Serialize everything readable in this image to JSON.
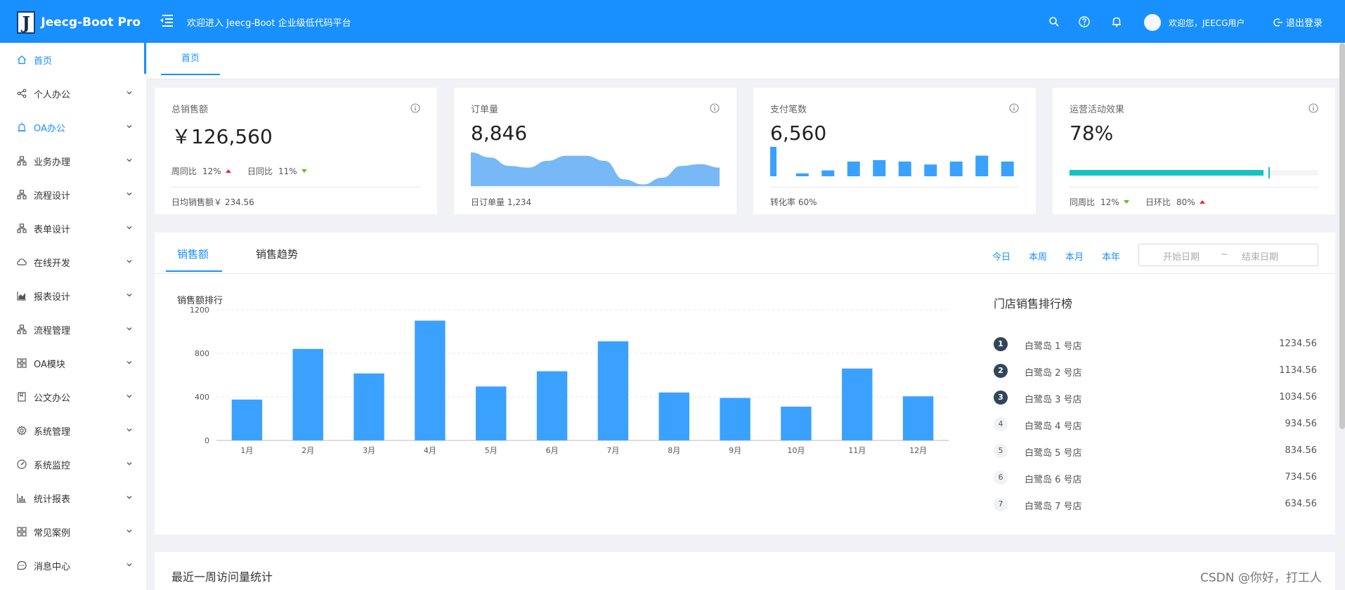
{
  "header": {
    "app_name": "Jeecg-Boot Pro",
    "logo_letter": "J",
    "welcome": "欢迎进入 Jeecg-Boot 企业级低代码平台",
    "user_greeting": "欢迎您，JEECG用户",
    "logout": "退出登录",
    "icons": [
      "menu-fold-icon",
      "search-icon",
      "question-icon",
      "bell-icon",
      "logout-icon"
    ]
  },
  "sidebar": {
    "items": [
      {
        "label": "首页",
        "icon": "home-icon",
        "active": true,
        "chevron": false
      },
      {
        "label": "个人办公",
        "icon": "share-icon",
        "active": false,
        "chevron": true
      },
      {
        "label": "OA办公",
        "icon": "alarm-icon",
        "active": true,
        "chevron": true
      },
      {
        "label": "业务办理",
        "icon": "cluster-icon",
        "active": false,
        "chevron": true
      },
      {
        "label": "流程设计",
        "icon": "cluster-icon",
        "active": false,
        "chevron": true
      },
      {
        "label": "表单设计",
        "icon": "cluster-icon",
        "active": false,
        "chevron": true
      },
      {
        "label": "在线开发",
        "icon": "cloud-icon",
        "active": false,
        "chevron": true
      },
      {
        "label": "报表设计",
        "icon": "area-chart-icon",
        "active": false,
        "chevron": true
      },
      {
        "label": "流程管理",
        "icon": "cluster-icon",
        "active": false,
        "chevron": true
      },
      {
        "label": "OA模块",
        "icon": "appstore-icon",
        "active": false,
        "chevron": true
      },
      {
        "label": "公文办公",
        "icon": "book-icon",
        "active": false,
        "chevron": true
      },
      {
        "label": "系统管理",
        "icon": "setting-icon",
        "active": false,
        "chevron": true
      },
      {
        "label": "系统监控",
        "icon": "dashboard-icon",
        "active": false,
        "chevron": true
      },
      {
        "label": "统计报表",
        "icon": "bar-chart-icon",
        "active": false,
        "chevron": true
      },
      {
        "label": "常见案例",
        "icon": "appstore-icon",
        "active": false,
        "chevron": true
      },
      {
        "label": "消息中心",
        "icon": "message-icon",
        "active": false,
        "chevron": true
      }
    ]
  },
  "tabs": {
    "home": "首页"
  },
  "stats": {
    "sales": {
      "title": "总销售额",
      "value": "￥126,560",
      "wow_label": "周同比",
      "wow_value": "12%",
      "dod_label": "日同比",
      "dod_value": "11%",
      "footer": "日均销售额￥ 234.56"
    },
    "orders": {
      "title": "订单量",
      "value": "8,846",
      "footer": "日订单量 1,234"
    },
    "payments": {
      "title": "支付笔数",
      "value": "6,560",
      "footer": "转化率 60%",
      "mini_bars": [
        100,
        10,
        20,
        50,
        55,
        50,
        40,
        50,
        70,
        50
      ]
    },
    "operation": {
      "title": "运营活动效果",
      "value": "78%",
      "progress": 0.78,
      "target": 0.8,
      "wow_label": "同周比",
      "wow_value": "12%",
      "dod_label": "日环比",
      "dod_value": "80%"
    }
  },
  "sales_panel": {
    "tabs": [
      "销售额",
      "销售趋势"
    ],
    "ranges": [
      "今日",
      "本周",
      "本月",
      "本年"
    ],
    "start_placeholder": "开始日期",
    "tilde": "~",
    "end_placeholder": "结束日期",
    "chart_title": "销售额排行",
    "ranking_title": "门店销售排行榜",
    "ranking": [
      {
        "rank": "1",
        "name": "白鹭岛 1 号店",
        "value": "1234.56"
      },
      {
        "rank": "2",
        "name": "白鹭岛 2 号店",
        "value": "1134.56"
      },
      {
        "rank": "3",
        "name": "白鹭岛 3 号店",
        "value": "1034.56"
      },
      {
        "rank": "4",
        "name": "白鹭岛 4 号店",
        "value": "934.56"
      },
      {
        "rank": "5",
        "name": "白鹭岛 5 号店",
        "value": "834.56"
      },
      {
        "rank": "6",
        "name": "白鹭岛 6 号店",
        "value": "734.56"
      },
      {
        "rank": "7",
        "name": "白鹭岛 7 号店",
        "value": "634.56"
      }
    ]
  },
  "visit": {
    "title": "最近一周访问量统计"
  },
  "watermark": "CSDN @你好，打工人",
  "colors": {
    "primary": "#1890ff",
    "bar": "#3ba1ff",
    "area": "#78b8f6",
    "progress": "#13c2c2",
    "up": "#f5222d",
    "down": "#52c41a"
  },
  "chart_data": [
    {
      "type": "bar",
      "title": "销售额排行",
      "categories": [
        "1月",
        "2月",
        "3月",
        "4月",
        "5月",
        "6月",
        "7月",
        "8月",
        "9月",
        "10月",
        "11月",
        "12月"
      ],
      "values": [
        375,
        840,
        615,
        1100,
        495,
        635,
        910,
        440,
        390,
        310,
        660,
        405
      ],
      "yticks": [
        "0",
        "400",
        "800",
        "1200"
      ],
      "ylim": [
        0,
        1200
      ],
      "grid": true
    },
    {
      "type": "area",
      "values": [
        10,
        8.5,
        6,
        5.5,
        7.5,
        9,
        9,
        7.5,
        2,
        0.5,
        2.5,
        6,
        6.5,
        5.5
      ]
    }
  ]
}
